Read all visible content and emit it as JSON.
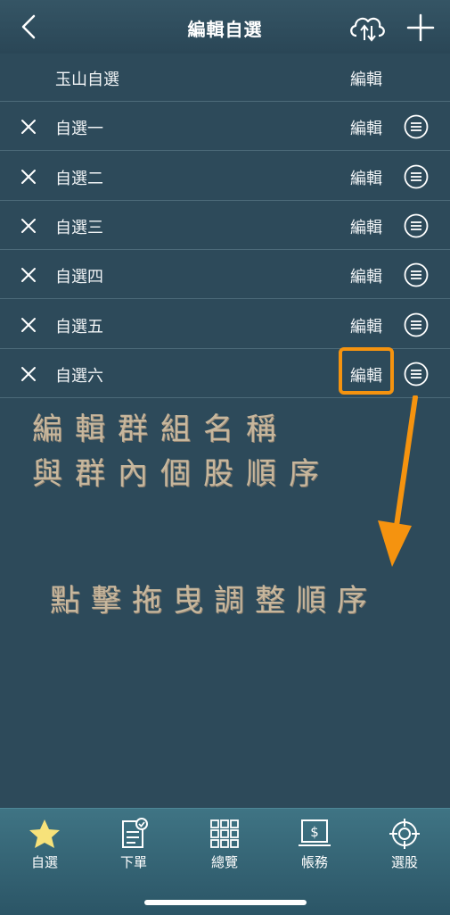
{
  "header": {
    "title": "編輯自選",
    "back_icon": "chevron-left-icon",
    "cloud_icon": "cloud-sync-icon",
    "add_icon": "plus-icon"
  },
  "lists": [
    {
      "name": "玉山自選",
      "edit": "編輯",
      "deletable": false
    },
    {
      "name": "自選一",
      "edit": "編輯",
      "deletable": true
    },
    {
      "name": "自選二",
      "edit": "編輯",
      "deletable": true
    },
    {
      "name": "自選三",
      "edit": "編輯",
      "deletable": true
    },
    {
      "name": "自選四",
      "edit": "編輯",
      "deletable": true
    },
    {
      "name": "自選五",
      "edit": "編輯",
      "deletable": true
    },
    {
      "name": "自選六",
      "edit": "編輯",
      "deletable": true
    }
  ],
  "annotations": {
    "line1": "編輯群組名稱",
    "line2": "與群內個股順序",
    "line3": "點擊拖曳調整順序"
  },
  "tabbar": [
    {
      "label": "自選",
      "icon": "star-icon"
    },
    {
      "label": "下單",
      "icon": "order-icon"
    },
    {
      "label": "總覽",
      "icon": "grid-icon"
    },
    {
      "label": "帳務",
      "icon": "account-icon"
    },
    {
      "label": "選股",
      "icon": "target-icon"
    }
  ],
  "colors": {
    "background": "#2d4a5a",
    "highlight": "#f5930f",
    "annotation_text": "#c7b79d",
    "star": "#f7e27a"
  }
}
